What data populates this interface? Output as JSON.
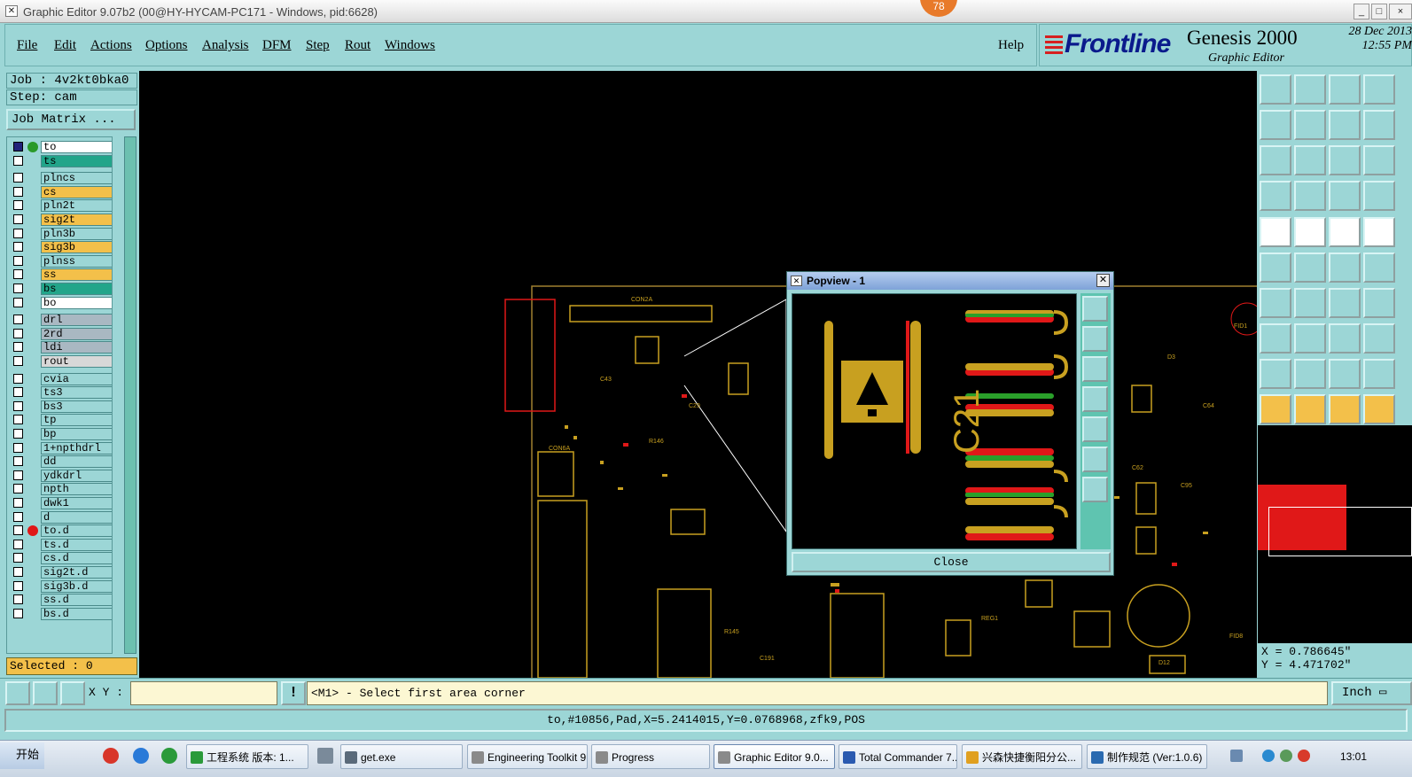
{
  "window": {
    "title": "Graphic Editor 9.07b2 (00@HY-HYCAM-PC171 - Windows, pid:6628)",
    "badge": "78"
  },
  "menu": {
    "items": [
      "File",
      "Edit",
      "Actions",
      "Options",
      "Analysis",
      "DFM",
      "Step",
      "Rout",
      "Windows"
    ],
    "help": "Help"
  },
  "brand": {
    "logo": "Frontline",
    "product": "Genesis 2000",
    "subtitle": "Graphic Editor",
    "date": "28 Dec 2013",
    "time": "12:55 PM"
  },
  "job": {
    "label": "Job : 4v2kt0bka0",
    "step": "Step: cam",
    "matrix_button": "Job Matrix ..."
  },
  "layers": [
    {
      "name": "to",
      "color": "#ffffff",
      "dot": "#2a9a2a"
    },
    {
      "name": "ts",
      "color": "#22a58a",
      "dot": ""
    },
    {
      "name": "plncs",
      "color": "#9cd6d6",
      "dot": ""
    },
    {
      "name": "cs",
      "color": "#f3c04a",
      "dot": ""
    },
    {
      "name": "pln2t",
      "color": "#9cd6d6",
      "dot": ""
    },
    {
      "name": "sig2t",
      "color": "#f3c04a",
      "dot": ""
    },
    {
      "name": "pln3b",
      "color": "#9cd6d6",
      "dot": ""
    },
    {
      "name": "sig3b",
      "color": "#f3c04a",
      "dot": ""
    },
    {
      "name": "plnss",
      "color": "#9cd6d6",
      "dot": ""
    },
    {
      "name": "ss",
      "color": "#f3c04a",
      "dot": ""
    },
    {
      "name": "bs",
      "color": "#22a58a",
      "dot": ""
    },
    {
      "name": "bo",
      "color": "#ffffff",
      "dot": ""
    },
    {
      "name": "drl",
      "color": "#a9b8c2",
      "dot": ""
    },
    {
      "name": "2rd",
      "color": "#a9b8c2",
      "dot": ""
    },
    {
      "name": "ldi",
      "color": "#a9b8c2",
      "dot": ""
    },
    {
      "name": "rout",
      "color": "#d8d8d8",
      "dot": ""
    },
    {
      "name": "cvia",
      "color": "#9cd6d6",
      "dot": ""
    },
    {
      "name": "ts3",
      "color": "#9cd6d6",
      "dot": ""
    },
    {
      "name": "bs3",
      "color": "#9cd6d6",
      "dot": ""
    },
    {
      "name": "tp",
      "color": "#9cd6d6",
      "dot": ""
    },
    {
      "name": "bp",
      "color": "#9cd6d6",
      "dot": ""
    },
    {
      "name": "1+npthdrl",
      "color": "#9cd6d6",
      "dot": ""
    },
    {
      "name": "dd",
      "color": "#9cd6d6",
      "dot": ""
    },
    {
      "name": "ydkdrl",
      "color": "#9cd6d6",
      "dot": ""
    },
    {
      "name": "npth",
      "color": "#9cd6d6",
      "dot": ""
    },
    {
      "name": "dwk1",
      "color": "#9cd6d6",
      "dot": ""
    },
    {
      "name": "d",
      "color": "#9cd6d6",
      "dot": ""
    },
    {
      "name": "to.d",
      "color": "#9cd6d6",
      "dot": "#e01818"
    },
    {
      "name": "ts.d",
      "color": "#9cd6d6",
      "dot": ""
    },
    {
      "name": "cs.d",
      "color": "#9cd6d6",
      "dot": ""
    },
    {
      "name": "sig2t.d",
      "color": "#9cd6d6",
      "dot": ""
    },
    {
      "name": "sig3b.d",
      "color": "#9cd6d6",
      "dot": ""
    },
    {
      "name": "ss.d",
      "color": "#9cd6d6",
      "dot": ""
    },
    {
      "name": "bs.d",
      "color": "#9cd6d6",
      "dot": ""
    }
  ],
  "selected": "Selected : 0",
  "popview": {
    "title": "Popview - 1",
    "close_label": "Close",
    "ref_label": "C21"
  },
  "status": {
    "xy_label": "X Y :",
    "xy_value": "",
    "prompt": "<M1> - Select first area corner",
    "unit": "Inch"
  },
  "info_line": "to,#10856,Pad,X=5.2414015,Y=0.0768968,zfk9,POS",
  "coords": {
    "x": "X = 0.786645\"",
    "y": "Y = 4.471702\""
  },
  "taskbar": {
    "start": "开始",
    "items": [
      "工程系统  版本: 1...",
      "get.exe",
      "Engineering Toolkit 9...",
      "Progress",
      "Graphic Editor 9.0...",
      "Total Commander 7....",
      "兴森快捷衡阳分公...",
      "制作规范 (Ver:1.0.6)"
    ],
    "clock": "13:01"
  }
}
